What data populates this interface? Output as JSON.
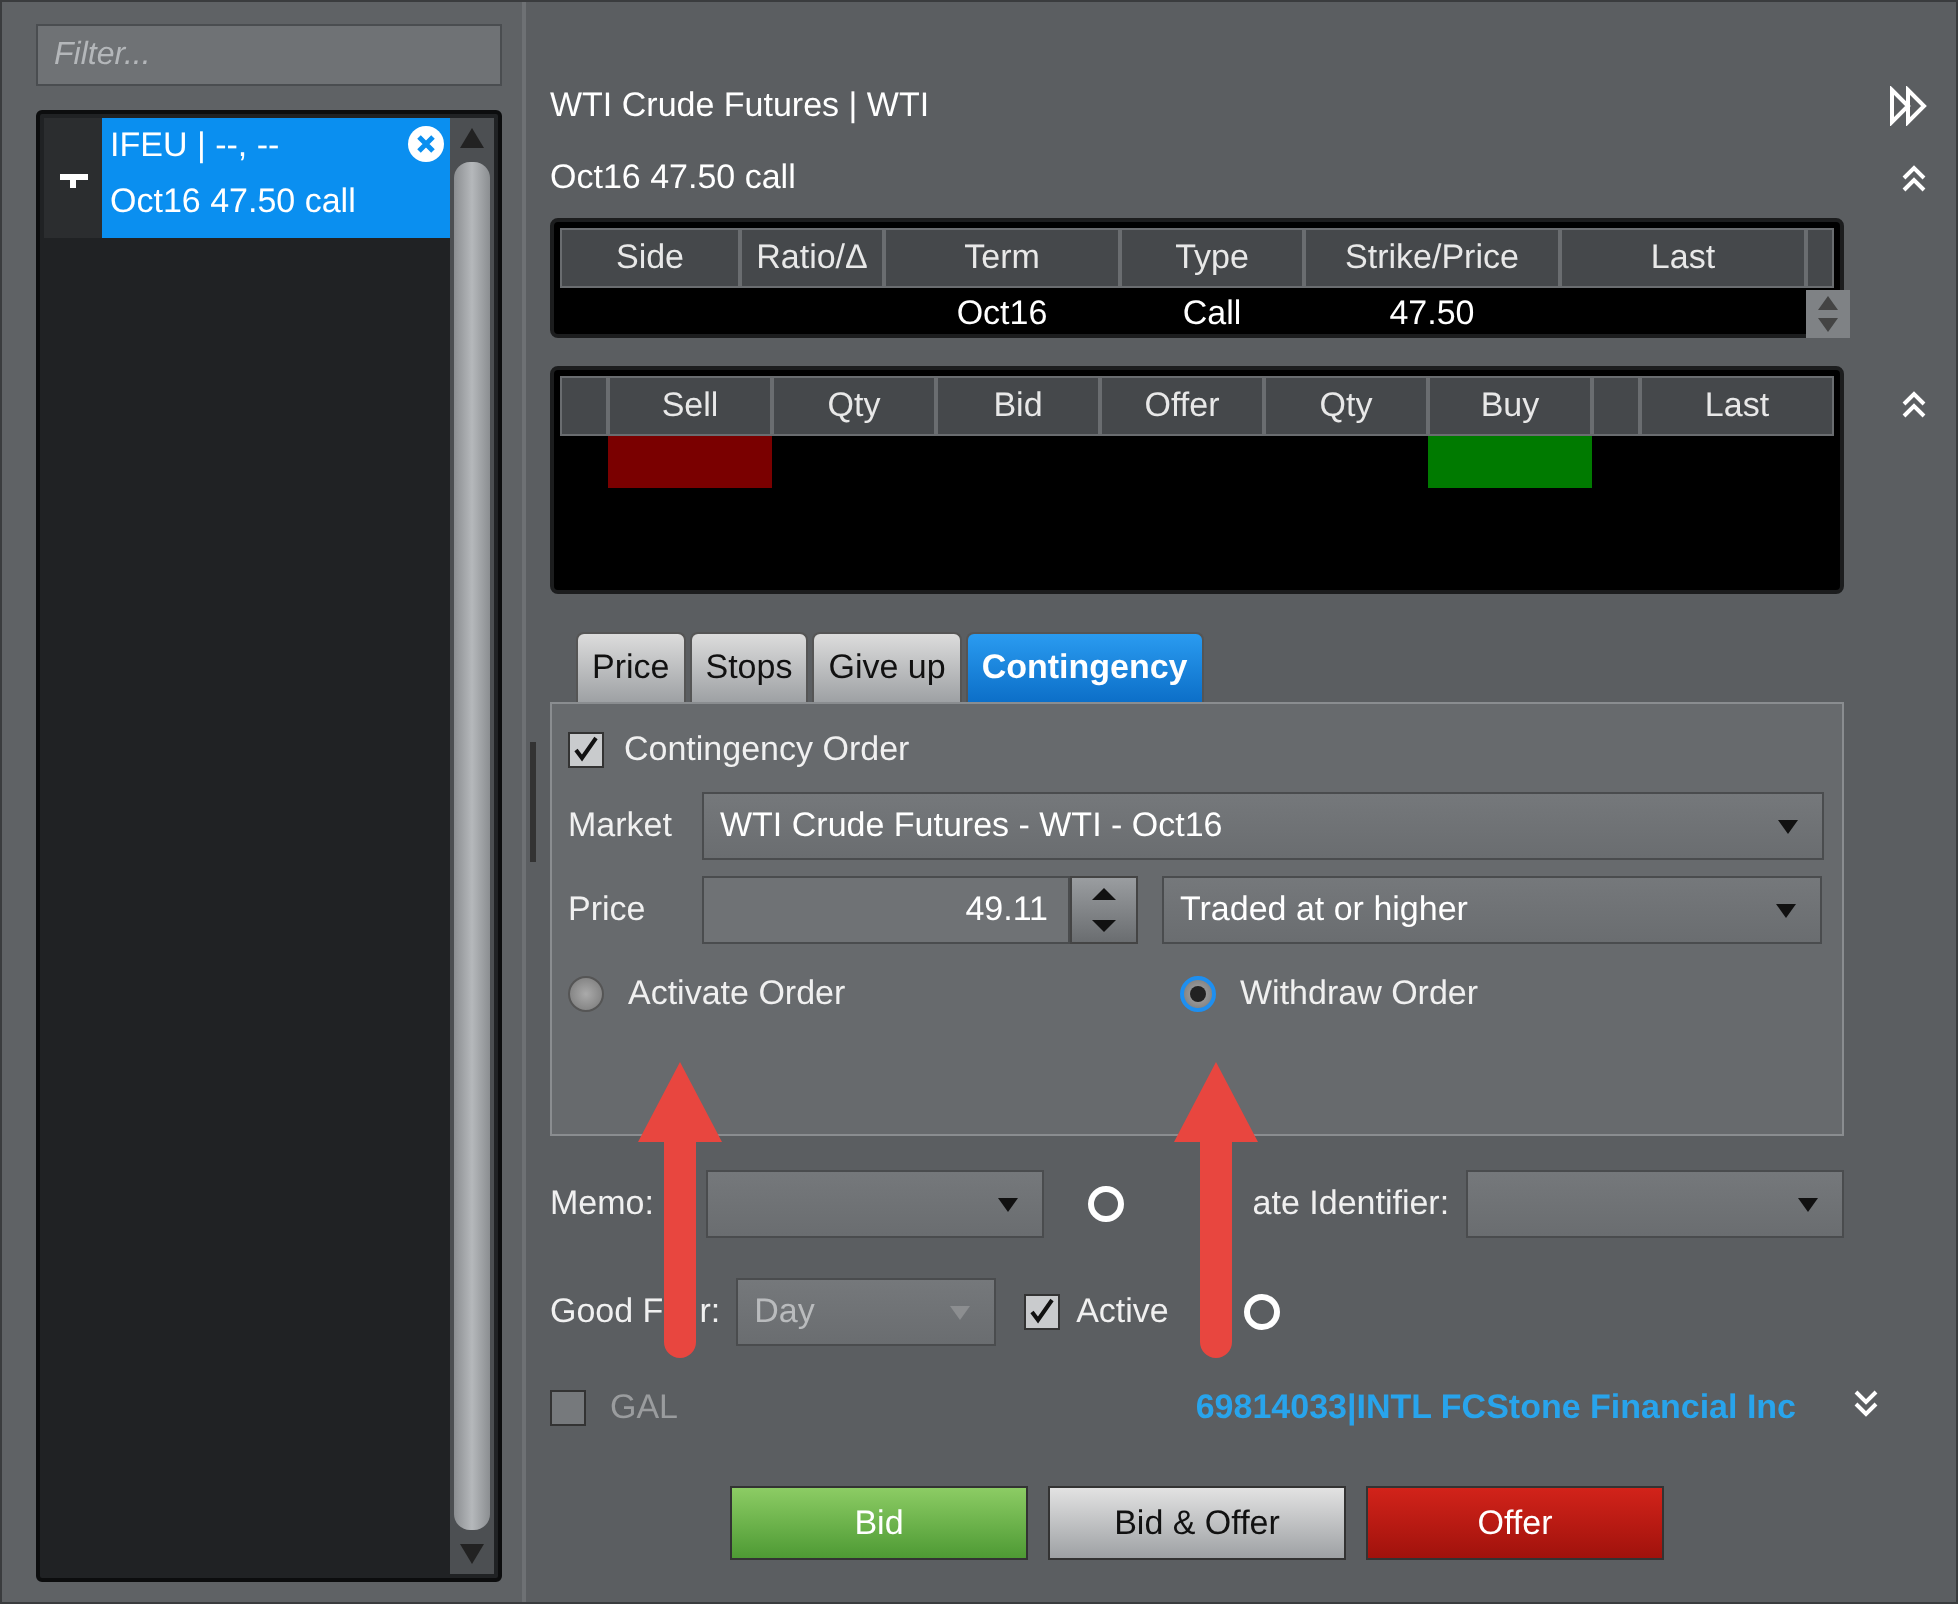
{
  "sidebar": {
    "filter": {
      "placeholder": "Filter..."
    },
    "items": [
      {
        "line1": "IFEU | --, --",
        "line2": "Oct16 47.50 call",
        "selected": true
      }
    ]
  },
  "instrument": {
    "title": "WTI Crude Futures | WTI",
    "subtitle": "Oct16 47.50 call"
  },
  "legs_table": {
    "columns": [
      "Side",
      "Ratio/Δ",
      "Term",
      "Type",
      "Strike/Price",
      "Last"
    ],
    "rows": [
      {
        "term": "Oct16",
        "type": "Call",
        "strike_price": "47.50"
      }
    ]
  },
  "depth_table": {
    "columns": [
      {
        "kind": "spacer"
      },
      {
        "kind": "label",
        "label": "Sell",
        "color": "#7a0000"
      },
      {
        "kind": "label",
        "label": "Qty"
      },
      {
        "kind": "label",
        "label": "Bid"
      },
      {
        "kind": "label",
        "label": "Offer"
      },
      {
        "kind": "label",
        "label": "Qty"
      },
      {
        "kind": "label",
        "label": "Buy",
        "color": "#007a00"
      },
      {
        "kind": "spacer"
      },
      {
        "kind": "label",
        "label": "Last"
      }
    ]
  },
  "tabs": [
    {
      "label": "Price",
      "selected": false
    },
    {
      "label": "Stops",
      "selected": false
    },
    {
      "label": "Give up",
      "selected": false
    },
    {
      "label": "Contingency",
      "selected": true
    }
  ],
  "contingency": {
    "checkbox": {
      "label": "Contingency Order",
      "checked": true
    },
    "market": {
      "label": "Market",
      "value": "WTI Crude Futures - WTI - Oct16"
    },
    "price": {
      "label": "Price",
      "value": "49.11"
    },
    "condition": {
      "value": "Traded at or higher"
    },
    "radios": [
      {
        "label": "Activate Order",
        "selected": false
      },
      {
        "label": "Withdraw Order",
        "selected": true
      }
    ]
  },
  "memo": {
    "label": "Memo:"
  },
  "rate_identifier": {
    "label": "ate Identifier:"
  },
  "good_for": {
    "label_parts": [
      "Good F",
      "r:"
    ],
    "value": "Day",
    "disabled": true
  },
  "active": {
    "label": "Active",
    "checked": true
  },
  "gal": {
    "label": "GAL",
    "checked": false,
    "disabled": true
  },
  "account": "69814033|INTL FCStone Financial Inc",
  "buttons": [
    {
      "kind": "bid",
      "label": "Bid"
    },
    {
      "kind": "both",
      "label": "Bid & Offer"
    },
    {
      "kind": "offer",
      "label": "Offer"
    }
  ]
}
